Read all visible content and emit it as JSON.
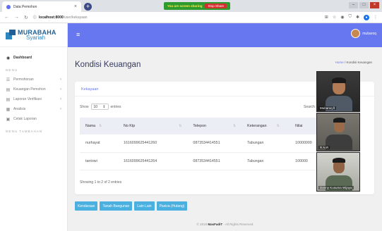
{
  "browser": {
    "tab_title": "Data Pemohon",
    "tab_close": "×",
    "new_tab": "+",
    "share_text": "You are screen sharing",
    "stop_share": "Stop Share",
    "url_host": "localhost:8000",
    "url_path": "/user/kekayaan"
  },
  "brand": {
    "line1": "MURABAHA",
    "line2": "Syariah"
  },
  "sidebar": {
    "dashboard": "Dashboard",
    "section_menu": "MENU",
    "items": [
      {
        "label": "Permohonan"
      },
      {
        "label": "Keuangan Pemohon"
      },
      {
        "label": "Laporan Verifikasi"
      },
      {
        "label": "Analisis"
      },
      {
        "label": "Cetak Laporan"
      }
    ],
    "section_tambahan": "MENU TAMBAHAN"
  },
  "topbar": {
    "username": "mubaroq"
  },
  "page": {
    "title": "Kondisi Keuangan",
    "breadcrumb_home": "Home",
    "breadcrumb_sep": "/",
    "breadcrumb_current": "Kondisi Keuangan"
  },
  "card": {
    "header": "Kekayaan",
    "show_label": "Show",
    "entries_value": "10",
    "entries_label": "entries",
    "search_label": "Search:"
  },
  "table": {
    "headers": [
      "Nama",
      "No Ktp",
      "Telepon",
      "Keterangan",
      "Nilai"
    ],
    "rows": [
      [
        "nurhayat",
        "1616099625441260",
        "0873534414551",
        "Tabungan",
        "10000000"
      ],
      [
        "tantowi",
        "1616099625441264",
        "0873534414551",
        "Tabungan",
        "100000"
      ]
    ],
    "info": "Showing 1 to 2 of 2 entries"
  },
  "buttons": [
    "Kendaraan",
    "Tanah Bangunan",
    "Lain Lain",
    "Pasiva (Hutang)"
  ],
  "footer": {
    "prefix": "© 2019",
    "brand": "MasFadiT",
    "suffix": "- All Rights Reserved"
  },
  "video": [
    {
      "name": "Mubaroq ll"
    },
    {
      "name": "R.N.R"
    },
    {
      "name": "Danny Kusuma Wijaya"
    }
  ],
  "colors": {
    "accent": "#6777ef",
    "button": "#4ab0e0",
    "share": "#2e9b2e",
    "stop": "#d32f2f"
  }
}
